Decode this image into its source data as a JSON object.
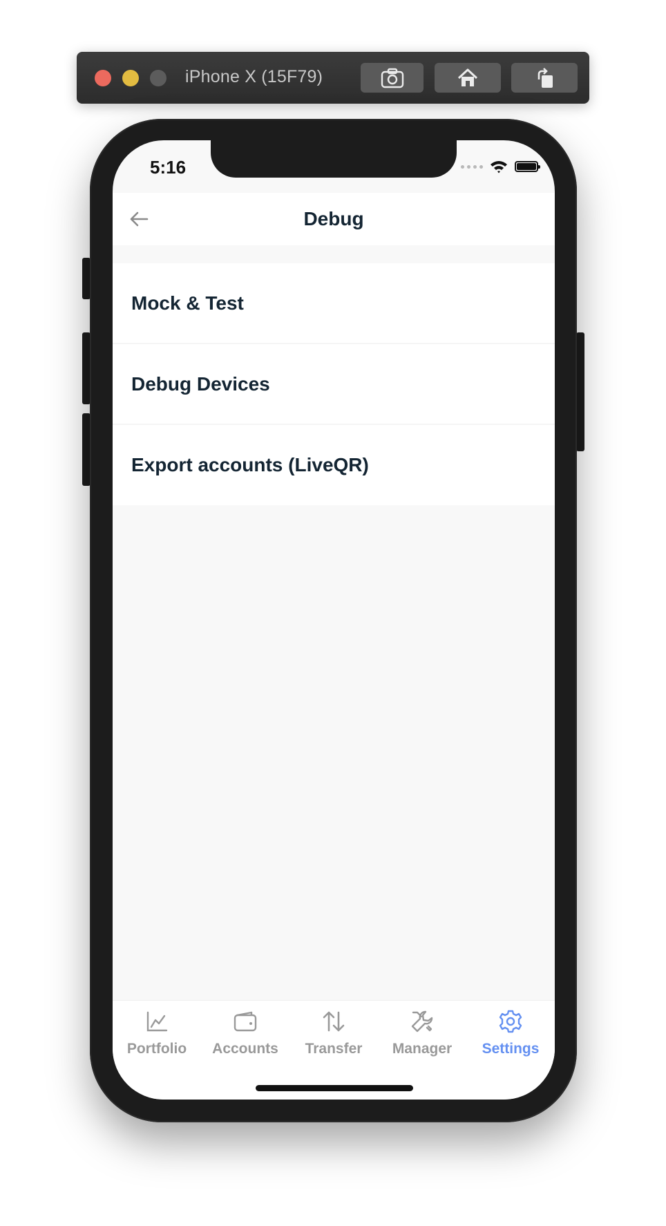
{
  "simulator": {
    "title": "iPhone X (15F79)",
    "buttons": [
      "screenshot-icon",
      "home-icon",
      "rotate-icon"
    ]
  },
  "status_bar": {
    "time": "5:16"
  },
  "header": {
    "title": "Debug",
    "back_icon": "arrow-left-icon"
  },
  "menu": {
    "items": [
      {
        "label": "Mock & Test"
      },
      {
        "label": "Debug Devices"
      },
      {
        "label": "Export accounts (LiveQR)"
      }
    ]
  },
  "tabbar": {
    "tabs": [
      {
        "label": "Portfolio",
        "icon": "chart-icon",
        "active": false
      },
      {
        "label": "Accounts",
        "icon": "wallet-icon",
        "active": false
      },
      {
        "label": "Transfer",
        "icon": "transfer-arrows-icon",
        "active": false
      },
      {
        "label": "Manager",
        "icon": "tools-icon",
        "active": false
      },
      {
        "label": "Settings",
        "icon": "gear-icon",
        "active": true
      }
    ]
  },
  "colors": {
    "accent": "#6490f1",
    "text_primary": "#142533",
    "tab_inactive": "#999999",
    "screen_bg": "#f8f8f8"
  }
}
